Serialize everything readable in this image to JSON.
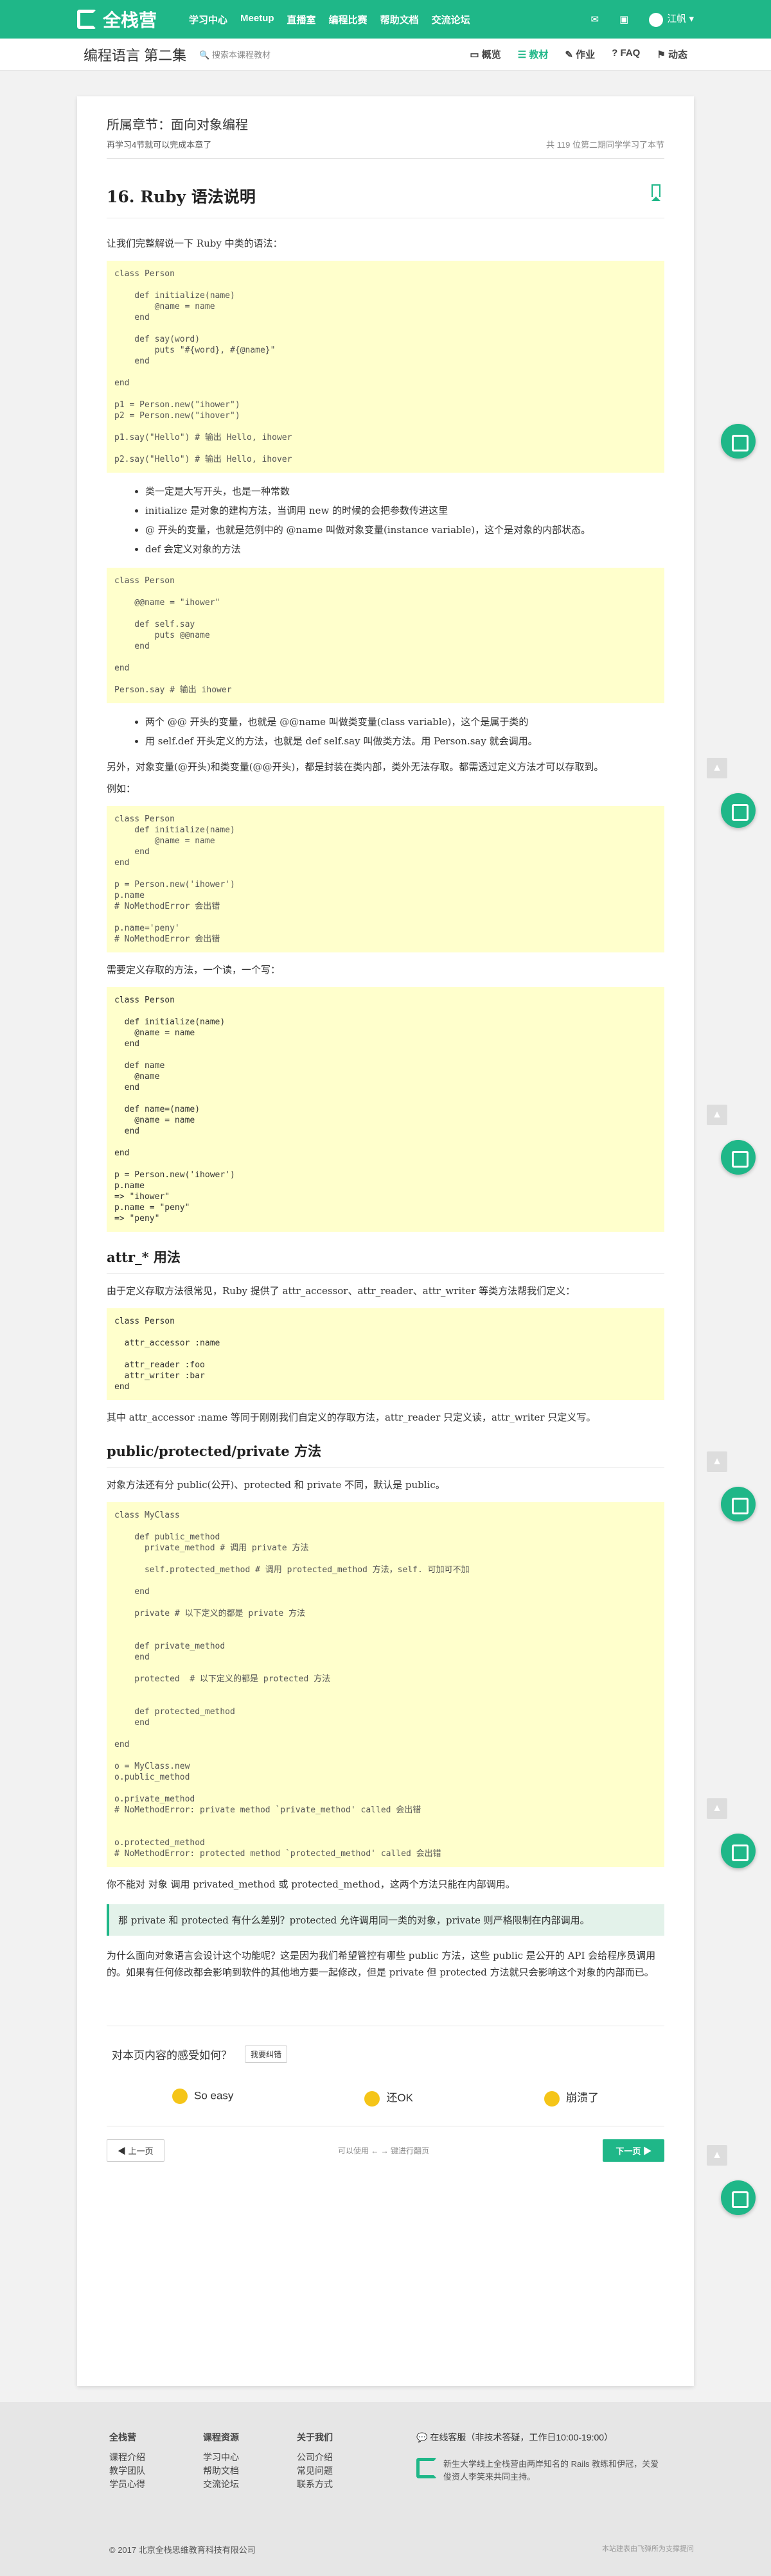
{
  "nav": {
    "brand": "全栈营",
    "links": [
      "学习中心",
      "Meetup",
      "直播室",
      "编程比赛",
      "帮助文档",
      "交流论坛"
    ],
    "user": "江帆"
  },
  "subbar": {
    "course": "编程语言 第二集",
    "search_placeholder": "搜索本课程教材",
    "tabs": [
      "概览",
      "教材",
      "作业",
      "FAQ",
      "动态"
    ]
  },
  "chapter": {
    "title": "所属章节：面向对象编程",
    "read_time": "再学习4节就可以完成本章了",
    "learners": "共 119 位第二期同学学习了本节"
  },
  "lesson": {
    "title": "16. Ruby 语法说明",
    "intro": "让我们完整解说一下 Ruby 中类的语法：",
    "code1": "class Person\n\n    def initialize(name)\n        @name = name\n    end\n\n    def say(word)\n        puts \"#{word}, #{@name}\"\n    end\n\nend\n\np1 = Person.new(\"ihower\")\np2 = Person.new(\"ihover\")\n\np1.say(\"Hello\") # 输出 Hello, ihower\n\np2.say(\"Hello\") # 输出 Hello, ihover",
    "bullets1": [
      "类一定是大写开头，也是一种常数",
      "initialize 是对象的建构方法，当调用 new 的时候的会把参数传进这里",
      "@ 开头的变量，也就是范例中的 @name 叫做对象变量(instance variable)，这个是对象的内部状态。",
      "def 会定义对象的方法"
    ],
    "code2": "class Person\n\n    @@name = \"ihower\"\n\n    def self.say\n        puts @@name\n    end\n\nend\n\nPerson.say # 输出 ihower",
    "bullets2": [
      "两个 @@ 开头的变量，也就是 @@name 叫做类变量(class variable)，这个是属于类的",
      "用 self.def 开头定义的方法，也就是 def self.say 叫做类方法。用 Person.say 就会调用。"
    ],
    "para1": "另外，对象变量(@开头)和类变量(@@开头)，都是封装在类内部，类外无法存取。都需透过定义方法才可以存取到。",
    "example": "例如：",
    "code3": "class Person\n    def initialize(name)\n        @name = name\n    end\nend\n\np = Person.new('ihower')\np.name\n# NoMethodError 会出错\n\np.name='peny'\n# NoMethodError 会出错",
    "para2": "需要定义存取的方法，一个读，一个写：",
    "code4": "class Person\n\n  def initialize(name)\n    @name = name\n  end\n\n  def name\n    @name\n  end\n\n  def name=(name)\n    @name = name\n  end\n\nend\n\np = Person.new('ihower')\np.name\n=> \"ihower\"\np.name = \"peny\"\n=> \"peny\"",
    "h_attr": "attr_* 用法",
    "para3": "由于定义存取方法很常见，Ruby 提供了 attr_accessor、attr_reader、attr_writer 等类方法帮我们定义：",
    "code5": "class Person\n\n  attr_accessor :name\n\n  attr_reader :foo\n  attr_writer :bar\nend",
    "para4": "其中 attr_accessor :name 等同于刚刚我们自定义的存取方法，attr_reader 只定义读，attr_writer 只定义写。",
    "h_access": "public/protected/private 方法",
    "para5": "对象方法还有分 public(公开)、protected 和 private 不同，默认是 public。",
    "code6": "class MyClass\n\n    def public_method\n      private_method # 调用 private 方法\n\n      self.protected_method # 调用 protected_method 方法，self. 可加可不加\n\n    end\n\n    private # 以下定义的都是 private 方法\n\n\n    def private_method\n    end\n\n    protected  # 以下定义的都是 protected 方法\n\n\n    def protected_method\n    end\n\nend\n\no = MyClass.new\no.public_method\n\no.private_method\n# NoMethodError: private method `private_method' called 会出错\n\n\no.protected_method\n# NoMethodError: protected method `protected_method' called 会出错",
    "para6": "你不能对 对象 调用 privated_method 或 protected_method，这两个方法只能在内部调用。",
    "tip": "那 private 和 protected 有什么差别？protected 允许调用同一类的对象，private 则严格限制在内部调用。",
    "para7": "为什么面向对象语言会设计这个功能呢？这是因为我们希望管控有哪些 public 方法，这些 public 是公开的 API 会给程序员调用的。如果有任何修改都会影响到软件的其他地方要一起修改，但是 private 但 protected 方法就只会影响这个对象的内部而已。"
  },
  "feedback": {
    "question": "对本页内容的感受如何？",
    "button": "我要纠错",
    "options": [
      "So easy",
      "还OK",
      "崩溃了"
    ]
  },
  "pager": {
    "prev": "上一页",
    "hint": "可以使用 ← → 键进行翻页",
    "next": "下一页"
  },
  "footer": {
    "cols": [
      {
        "title": "全栈营",
        "items": [
          "课程介绍",
          "教学团队",
          "学员心得"
        ]
      },
      {
        "title": "课程资源",
        "items": [
          "学习中心",
          "帮助文档",
          "交流论坛"
        ]
      },
      {
        "title": "关于我们",
        "items": [
          "公司介绍",
          "常见问题",
          "联系方式"
        ]
      }
    ],
    "service": "在线客服（非技术答疑，工作日10:00-19:00）",
    "ad": "新生大学线上全栈营由两岸知名的 Rails 教练和伊冠，关爱俊资人李笑来共同主持。",
    "copyright": "© 2017 北京全栈思维教育科技有限公司",
    "right": "本站建表由飞弹所为支撑提问"
  },
  "colors": {
    "accent": "#1fb788",
    "code_bg": "#ffffcc"
  }
}
